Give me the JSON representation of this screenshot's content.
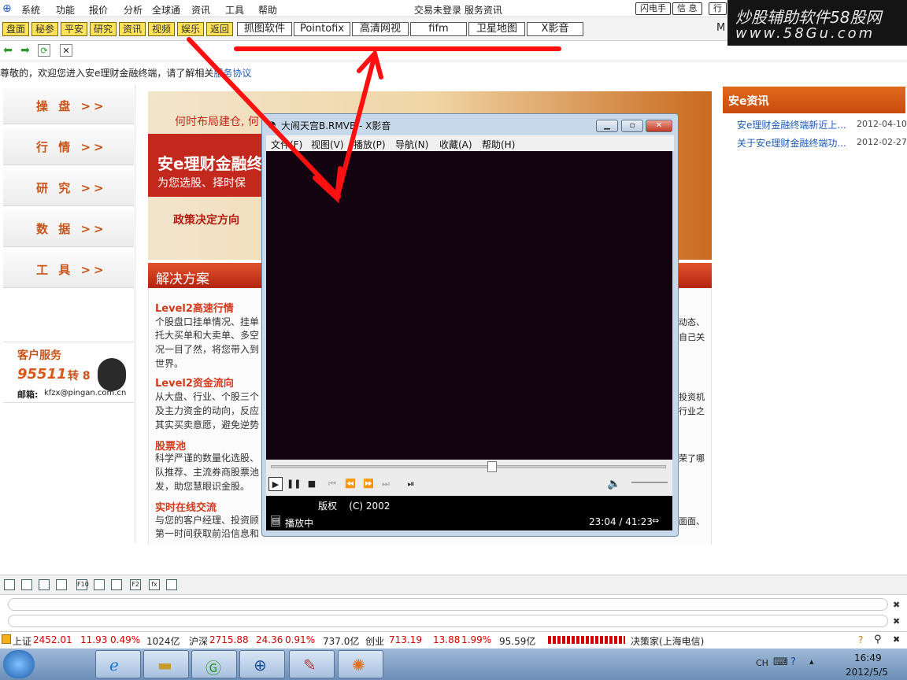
{
  "menubar": {
    "items": [
      "系统",
      "功能",
      "报价",
      "分析",
      "全球通",
      "资讯",
      "工具",
      "帮助"
    ],
    "center_text": "交易未登录  服务资讯",
    "right_buttons": [
      "闪电手",
      "信 息",
      "行"
    ]
  },
  "toolbar": {
    "yellow_buttons": [
      "盘面",
      "秘参",
      "平安",
      "研究",
      "资讯",
      "视频",
      "娱乐",
      "返回"
    ],
    "white_buttons": [
      "抓图软件",
      "Pointofix",
      "高清网视",
      "fifm",
      "卫星地图",
      "X影音"
    ],
    "overflow_letter": "M"
  },
  "welcome": {
    "text": "尊敬的，欢迎您进入安e理财金融终端，请了解相关",
    "link": "服务协议"
  },
  "leftnav": {
    "items": [
      "操 盘 >>",
      "行 情 >>",
      "研 究 >>",
      "数 据 >>",
      "工 具 >>"
    ]
  },
  "service": {
    "title": "客户服务",
    "phone": "95511",
    "ext": "转 8",
    "email_label": "邮箱:",
    "email": "kfzx@pingan.com.cn"
  },
  "banner": {
    "line1": "何时布局建仓, 何",
    "title": "安e理财金融终",
    "subtitle": "为您选股、择时保",
    "policy": "政策决定方向"
  },
  "solution": {
    "header": "解决方案",
    "sections": [
      {
        "title": "Level2高速行情",
        "lines": [
          "个股盘口挂单情况、挂单",
          "托大买单和大卖单、多空",
          "况一目了然，将您带入到",
          "世界。"
        ]
      },
      {
        "title": "Level2资金流向",
        "lines": [
          "从大盘、行业、个股三个",
          "及主力资金的动向，反应",
          "其实买卖意愿，避免逆势"
        ]
      },
      {
        "title": "股票池",
        "lines": [
          "科学严谨的数量化选股、",
          "队推荐、主流券商股票池",
          "发，助您慧眼识金股。"
        ]
      },
      {
        "title": "实时在线交流",
        "lines": [
          "与您的客户经理、投资顾",
          "第一时间获取前沿信息和"
        ]
      }
    ],
    "right_fragments": [
      "动态、",
      "自己关",
      "投资机",
      "行业之",
      "荣了哪",
      "面面、"
    ]
  },
  "news": {
    "title": "安e资讯",
    "items": [
      {
        "text": "安e理财金融终端新近上...",
        "date": "2012-04-10"
      },
      {
        "text": "关于安e理财金融终端功...",
        "date": "2012-02-27"
      }
    ]
  },
  "player": {
    "title": "大闹天宫B.RMVB - X影音",
    "menu": [
      "文件(F)",
      "视图(V)",
      "播放(P)",
      "导航(N)",
      "收藏(A)",
      "帮助(H)"
    ],
    "copyright_label": "版权",
    "copyright_value": "(C) 2002",
    "status": "播放中",
    "time": "23:04 / 41:23",
    "progress_fraction": 0.56
  },
  "iconbar": {
    "icons": [
      "grid-icon",
      "table-icon",
      "line-icon",
      "bars-icon",
      "f10-icon",
      "doc-icon",
      "note-icon",
      "f2-icon",
      "fx-icon",
      "zoom-icon"
    ],
    "labels": [
      "",
      "",
      "",
      "",
      "F10",
      "",
      "",
      "F2",
      "fx",
      ""
    ]
  },
  "ticker": {
    "sh_label": "上证",
    "sh_index": "2452.01",
    "sh_change": "11.93",
    "sh_pct": "0.49%",
    "sh_vol": "1024亿",
    "sz_label": "沪深",
    "sz_index": "2715.88",
    "sz_change": "24.36",
    "sz_pct": "0.91%",
    "sz_vol": "737.0亿",
    "cy_label": "创业",
    "cy_index": "713.19",
    "cy_change": "13.88",
    "cy_pct": "1.99%",
    "cy_vol": "95.59亿",
    "server": "决策家(上海电信)"
  },
  "taskbar": {
    "lang": "CH",
    "time": "16:49",
    "date": "2012/5/5"
  },
  "watermark": {
    "line1": "炒股辅助软件58股网",
    "line2": "www.58Gu.com"
  },
  "colors": {
    "accent_red": "#c2281c",
    "accent_orange": "#d8581a",
    "annotation_red": "#ff1010",
    "player_screen": "#140310"
  }
}
